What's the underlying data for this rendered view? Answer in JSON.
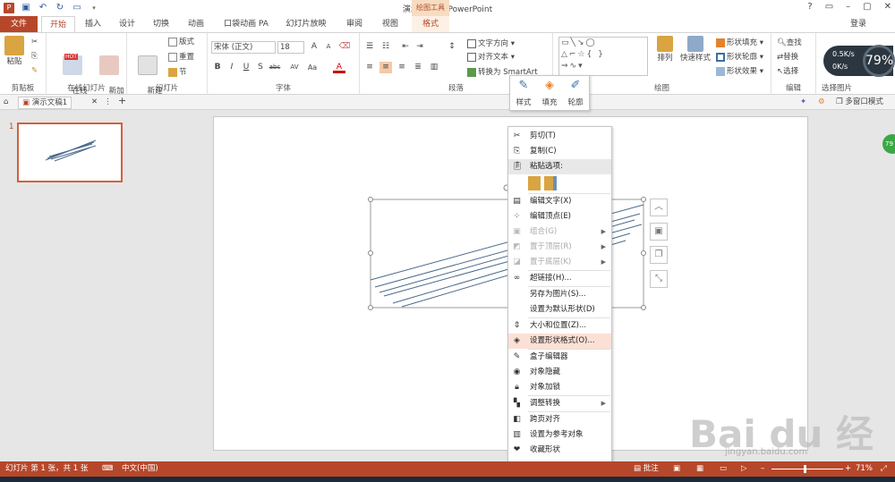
{
  "window": {
    "title": "演示文稿1 - PowerPoint",
    "contextual_tab_group": "绘图工具",
    "controls": [
      "?",
      "▭",
      "–",
      "▢",
      "✕"
    ],
    "sign_in": "登录"
  },
  "tabs": [
    "文件",
    "开始",
    "插入",
    "设计",
    "切换",
    "动画",
    "口袋动画 PA",
    "幻灯片放映",
    "审阅",
    "视图",
    "格式"
  ],
  "ribbon": {
    "clipboard": {
      "label": "剪贴板",
      "paste": "粘贴"
    },
    "online_slides": {
      "label": "在线幻灯片",
      "online": "在线\n幻灯片",
      "new_anim": "新加\n动画页",
      "hot": "HOT"
    },
    "slides": {
      "label": "幻灯片",
      "new_slide": "新建\n幻灯片",
      "layout": "版式",
      "reset": "重置",
      "section": "节"
    },
    "font": {
      "label": "字体",
      "font_name": "宋体 (正文)",
      "font_size": "18"
    },
    "paragraph": {
      "label": "段落",
      "text_direction": "文字方向",
      "align_text": "对齐文本",
      "convert_smartart": "转换为 SmartArt"
    },
    "drawing": {
      "label": "绘图",
      "arrange": "排列",
      "quick_styles": "快速样式",
      "shape_fill": "形状填充",
      "shape_outline": "形状轮廓",
      "shape_effects": "形状效果"
    },
    "editing": {
      "label": "编辑",
      "find": "查找",
      "replace": "替换",
      "select": "选择"
    },
    "select_picture": {
      "label": "选择图片"
    }
  },
  "doc_tab": {
    "name": "演示文稿1",
    "multi_window": "多窗口模式"
  },
  "slide_number": "1",
  "mini_toolbar": {
    "style": "样式",
    "fill": "填充",
    "outline": "轮廓"
  },
  "context_menu": [
    {
      "icon": "scissors-icon",
      "label": "剪切(T)",
      "state": "normal"
    },
    {
      "icon": "copy-icon",
      "label": "复制(C)",
      "state": "normal"
    },
    {
      "icon": "paste-icon",
      "label": "粘贴选项:",
      "state": "header"
    },
    {
      "icon": "edit-text-icon",
      "label": "编辑文字(X)",
      "state": "normal"
    },
    {
      "icon": "edit-points-icon",
      "label": "编辑顶点(E)",
      "state": "normal"
    },
    {
      "icon": "group-icon",
      "label": "组合(G)",
      "state": "disabled",
      "submenu": true
    },
    {
      "icon": "bring-front-icon",
      "label": "置于顶层(R)",
      "state": "disabled",
      "submenu": true
    },
    {
      "icon": "send-back-icon",
      "label": "置于底层(K)",
      "state": "disabled",
      "submenu": true
    },
    {
      "icon": "hyperlink-icon",
      "label": "超链接(H)...",
      "state": "normal"
    },
    {
      "icon": "",
      "label": "另存为图片(S)...",
      "state": "normal"
    },
    {
      "icon": "",
      "label": "设置为默认形状(D)",
      "state": "normal"
    },
    {
      "icon": "size-position-icon",
      "label": "大小和位置(Z)...",
      "state": "normal"
    },
    {
      "icon": "format-shape-icon",
      "label": "设置形状格式(O)...",
      "state": "highlight"
    },
    {
      "icon": "box-editor-icon",
      "label": "盒子编辑器",
      "state": "normal"
    },
    {
      "icon": "hide-object-icon",
      "label": "对象隐藏",
      "state": "normal"
    },
    {
      "icon": "lock-icon",
      "label": "对象加锁",
      "state": "normal"
    },
    {
      "icon": "convert-icon",
      "label": "调整转换",
      "state": "normal",
      "submenu": true
    },
    {
      "icon": "cross-page-align-icon",
      "label": "跨页对齐",
      "state": "normal"
    },
    {
      "icon": "reference-object-icon",
      "label": "设置为参考对象",
      "state": "normal"
    },
    {
      "icon": "collect-shape-icon",
      "label": "收藏形状",
      "state": "normal"
    }
  ],
  "net_monitor": {
    "up": "0.5K/s",
    "down": "0K/s",
    "percent": "79%",
    "ball": "79"
  },
  "status_bar": {
    "slide_info": "幻灯片 第 1 张，共 1 张",
    "language": "中文(中国)",
    "notes": "批注",
    "zoom": "71%"
  },
  "watermark": {
    "text": "Bai du 经验",
    "url": "jingyan.baidu.com"
  },
  "colors": {
    "accent": "#b7472a",
    "highlight": "#fbe0d6",
    "line": "#4a6a8c"
  }
}
